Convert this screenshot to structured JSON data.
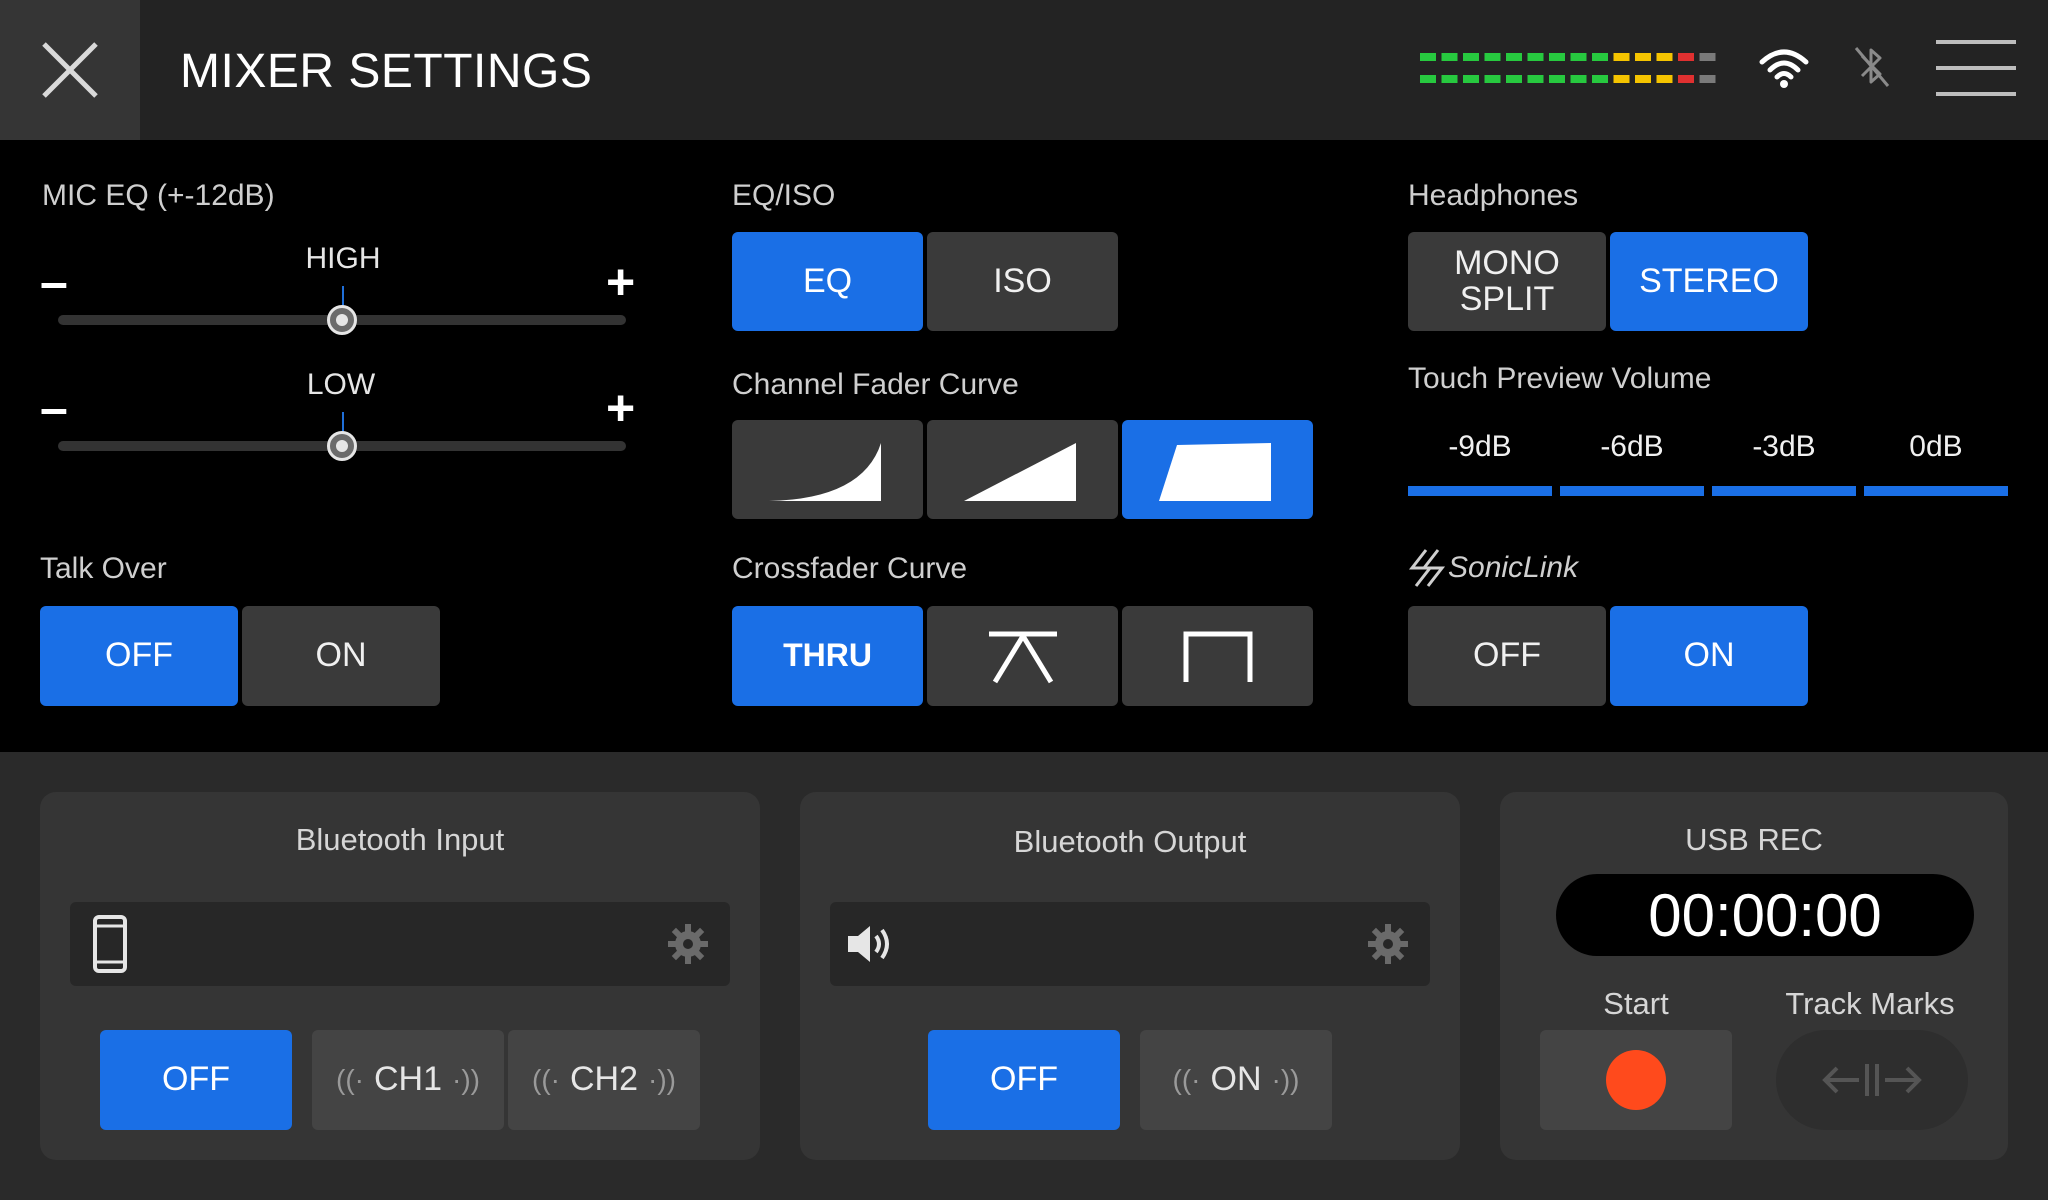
{
  "header": {
    "title": "MIXER SETTINGS"
  },
  "mic_eq": {
    "label": "MIC EQ (+-12dB)",
    "high_label": "HIGH",
    "low_label": "LOW",
    "minus": "–",
    "plus": "+",
    "high_level": 0.5,
    "low_level": 0.5
  },
  "talk_over": {
    "label": "Talk Over",
    "off": "OFF",
    "on": "ON",
    "selected": "OFF"
  },
  "eq_iso": {
    "label": "EQ/ISO",
    "eq": "EQ",
    "iso": "ISO",
    "selected": "EQ"
  },
  "channel_fader_curve": {
    "label": "Channel Fader Curve",
    "options": [
      "slow-cut-curve",
      "linear-curve",
      "fast-cut-curve"
    ],
    "selected": 2
  },
  "crossfader_curve": {
    "label": "Crossfader Curve",
    "thru": "THRU",
    "options": [
      "thru",
      "constant-power-curve",
      "sharp-cut-curve"
    ],
    "selected": 0
  },
  "headphones": {
    "label": "Headphones",
    "mono_line1": "MONO",
    "mono_line2": "SPLIT",
    "stereo": "STEREO",
    "selected": "STEREO"
  },
  "touch_preview": {
    "label": "Touch Preview Volume",
    "options": [
      "-9dB",
      "-6dB",
      "-3dB",
      "0dB"
    ]
  },
  "soniclink": {
    "label": "SonicLink",
    "off": "OFF",
    "on": "ON",
    "selected": "ON"
  },
  "bluetooth_input": {
    "title": "Bluetooth Input",
    "off": "OFF",
    "ch1": "CH1",
    "ch2": "CH2",
    "selected": "OFF"
  },
  "bluetooth_output": {
    "title": "Bluetooth Output",
    "off": "OFF",
    "on": "ON",
    "selected": "OFF"
  },
  "usb_rec": {
    "title": "USB REC",
    "time": "00:00:00",
    "start_label": "Start",
    "track_marks_label": "Track Marks"
  },
  "colors": {
    "accent": "#1a6fe6",
    "record": "#ff4a1c"
  }
}
